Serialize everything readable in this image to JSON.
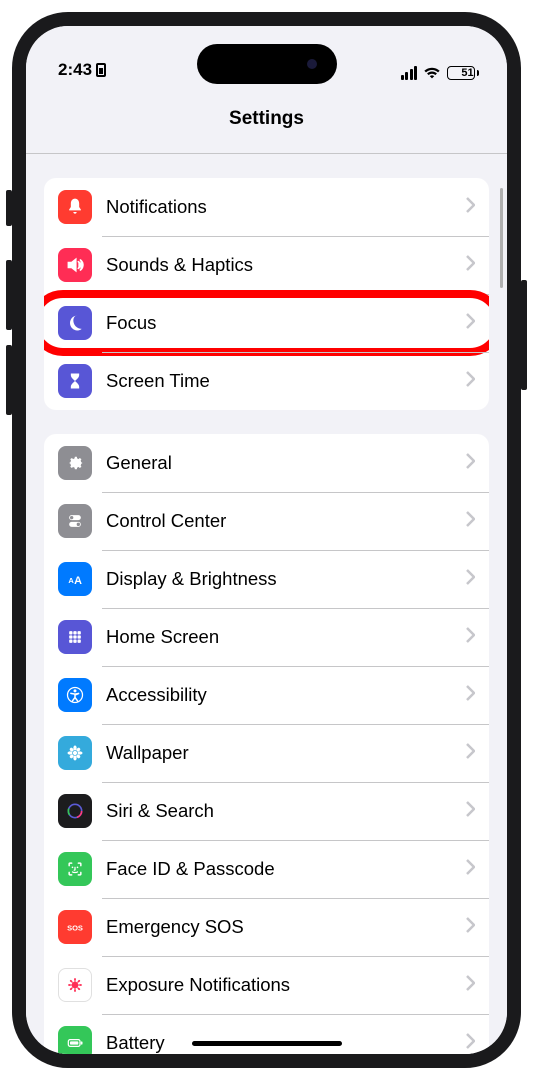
{
  "status": {
    "time": "2:43",
    "battery": "51"
  },
  "header": {
    "title": "Settings"
  },
  "groups": [
    {
      "rows": [
        {
          "label": "Notifications"
        },
        {
          "label": "Sounds & Haptics"
        },
        {
          "label": "Focus"
        },
        {
          "label": "Screen Time"
        }
      ]
    },
    {
      "rows": [
        {
          "label": "General"
        },
        {
          "label": "Control Center"
        },
        {
          "label": "Display & Brightness"
        },
        {
          "label": "Home Screen"
        },
        {
          "label": "Accessibility"
        },
        {
          "label": "Wallpaper"
        },
        {
          "label": "Siri & Search"
        },
        {
          "label": "Face ID & Passcode"
        },
        {
          "label": "Emergency SOS"
        },
        {
          "label": "Exposure Notifications"
        },
        {
          "label": "Battery"
        }
      ]
    }
  ]
}
